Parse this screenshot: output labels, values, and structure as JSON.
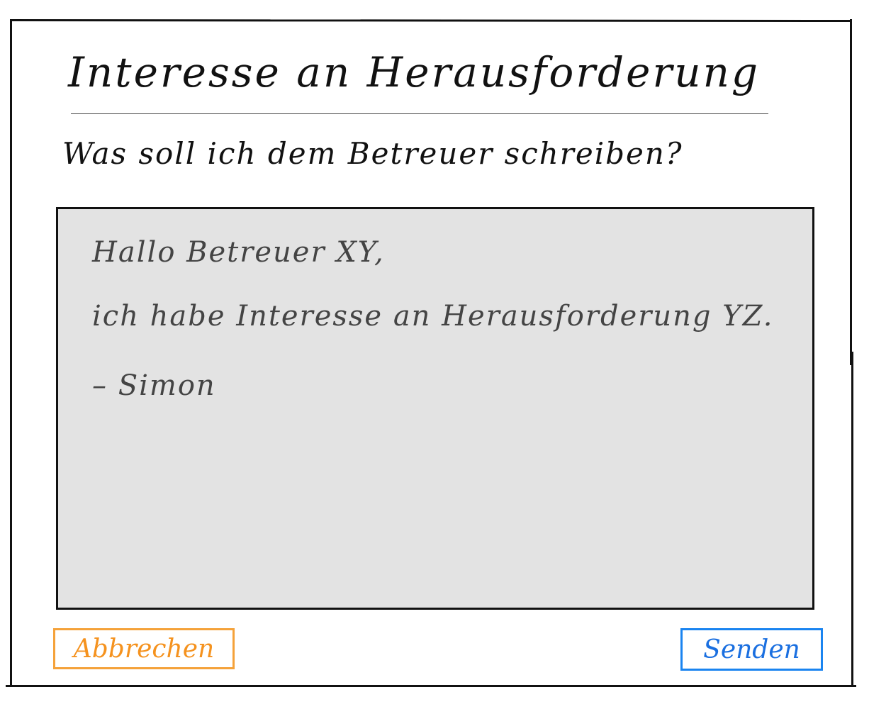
{
  "dialog": {
    "title": "Interesse an Herausforderung",
    "prompt": "Was soll ich dem Betreuer schreiben?"
  },
  "message": {
    "lines": [
      "Hallo Betreuer XY,",
      "ich habe Interesse an Herausforderung YZ.",
      "– Simon"
    ]
  },
  "actions": {
    "cancel_label": "Abbrechen",
    "send_label": "Senden"
  },
  "colors": {
    "cancel": "#f5a23a",
    "send": "#1a84f0",
    "message_background": "#e3e3e3"
  }
}
